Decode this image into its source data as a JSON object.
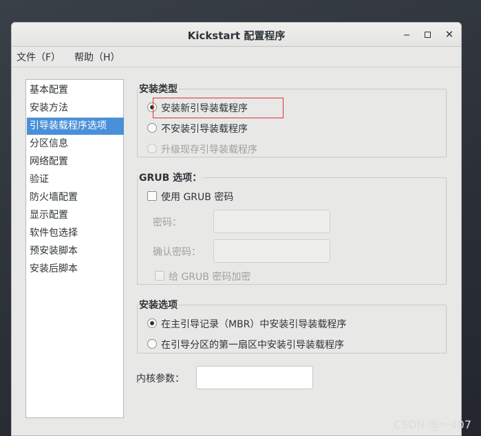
{
  "window": {
    "title": "Kickstart 配置程序",
    "controls": {
      "minimize": "‒",
      "maximize": "▫",
      "close": "✕"
    }
  },
  "menu": [
    "文件（F）",
    "帮助（H）"
  ],
  "sidebar": {
    "items": [
      "基本配置",
      "安装方法",
      "引导装载程序选项",
      "分区信息",
      "网络配置",
      "验证",
      "防火墙配置",
      "显示配置",
      "软件包选择",
      "预安装脚本",
      "安装后脚本"
    ],
    "selected_index": 2
  },
  "install_type": {
    "title": "安装类型",
    "options": [
      {
        "label": "安装新引导装载程序",
        "checked": true,
        "disabled": false
      },
      {
        "label": "不安装引导装载程序",
        "checked": false,
        "disabled": false
      },
      {
        "label": "升级现存引导装载程序",
        "checked": false,
        "disabled": true
      }
    ]
  },
  "grub": {
    "title": "GRUB 选项：",
    "use_password_label": "使用  GRUB 密码",
    "use_password_checked": false,
    "password_label": "密码：",
    "password_value": "",
    "confirm_label": "确认密码：",
    "confirm_value": "",
    "encrypt_label": "给  GRUB 密码加密",
    "encrypt_checked": false
  },
  "install_options": {
    "title": "安装选项",
    "options": [
      {
        "label": "在主引导记录（MBR）中安装引导装载程序",
        "checked": true
      },
      {
        "label": "在引导分区的第一扇区中安装引导装载程序",
        "checked": false
      }
    ]
  },
  "kernel": {
    "label": "内核参数：",
    "value": ""
  },
  "watermark": "CSDN @～407"
}
